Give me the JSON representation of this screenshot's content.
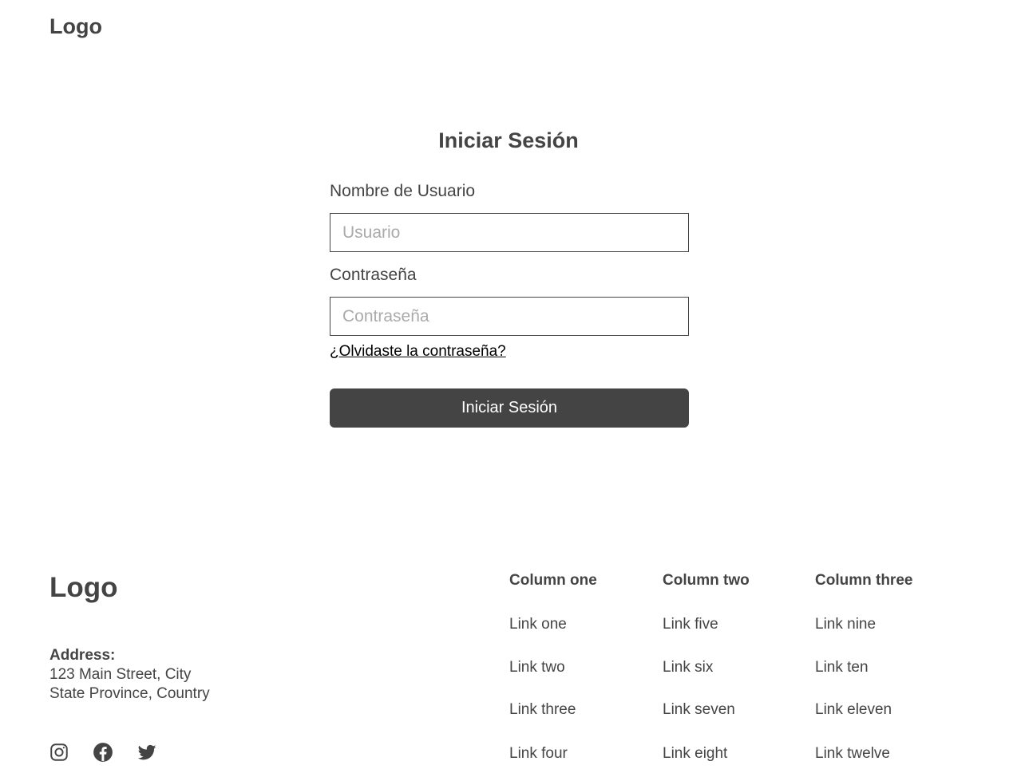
{
  "header": {
    "logo": "Logo"
  },
  "login": {
    "title": "Iniciar Sesión",
    "username_label": "Nombre de Usuario",
    "username_placeholder": "Usuario",
    "username_value": "",
    "password_label": "Contraseña",
    "password_placeholder": "Contraseña",
    "password_value": "",
    "forgot_link": "¿Olvidaste la contraseña?",
    "submit_label": "Iniciar Sesión"
  },
  "footer": {
    "logo": "Logo",
    "address_label": "Address:",
    "address_line1": "123 Main Street, City",
    "address_line2": "State Province, Country",
    "social_icons": [
      "instagram-icon",
      "facebook-icon",
      "twitter-icon"
    ],
    "columns": [
      {
        "heading": "Column one",
        "links": [
          "Link one",
          "Link two",
          "Link three",
          "Link four"
        ]
      },
      {
        "heading": "Column two",
        "links": [
          "Link five",
          "Link six",
          "Link seven",
          "Link eight"
        ]
      },
      {
        "heading": "Column three",
        "links": [
          "Link nine",
          "Link ten",
          "Link eleven",
          "Link twelve"
        ]
      }
    ]
  },
  "colors": {
    "text": "#444444",
    "button_bg": "#444444",
    "button_text": "#ffffff",
    "link": "#000000",
    "placeholder": "#aaaaaa"
  }
}
